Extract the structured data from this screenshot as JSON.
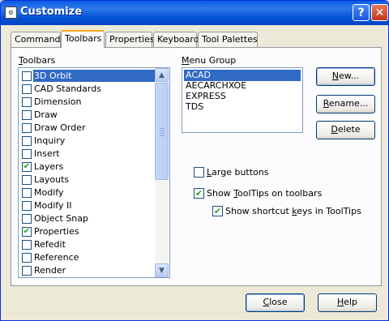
{
  "window": {
    "title": "Customize",
    "help_glyph": "?",
    "close_glyph": "✕",
    "app_icon": "⚙"
  },
  "tabs": [
    {
      "label": "Commands"
    },
    {
      "label": "Toolbars"
    },
    {
      "label": "Properties"
    },
    {
      "label": "Keyboard"
    },
    {
      "label": "Tool Palettes"
    }
  ],
  "active_tab": "Toolbars",
  "toolbars_section": {
    "label_access": "T",
    "label_rest": "oolbars",
    "items": [
      {
        "label": "3D Orbit",
        "checked": false,
        "selected": true
      },
      {
        "label": "CAD Standards",
        "checked": false
      },
      {
        "label": "Dimension",
        "checked": false
      },
      {
        "label": "Draw",
        "checked": false
      },
      {
        "label": "Draw Order",
        "checked": false
      },
      {
        "label": "Inquiry",
        "checked": false
      },
      {
        "label": "Insert",
        "checked": false
      },
      {
        "label": "Layers",
        "checked": true
      },
      {
        "label": "Layouts",
        "checked": false
      },
      {
        "label": "Modify",
        "checked": false
      },
      {
        "label": "Modify II",
        "checked": false
      },
      {
        "label": "Object Snap",
        "checked": false
      },
      {
        "label": "Properties",
        "checked": true
      },
      {
        "label": "Refedit",
        "checked": false
      },
      {
        "label": "Reference",
        "checked": false
      },
      {
        "label": "Render",
        "checked": false
      }
    ]
  },
  "menu_group": {
    "label_pre": "",
    "label_access": "M",
    "label_rest": "enu Group",
    "items": [
      {
        "label": "ACAD",
        "selected": true
      },
      {
        "label": "AECARCHXOE"
      },
      {
        "label": "EXPRESS"
      },
      {
        "label": "TDS"
      }
    ]
  },
  "buttons": {
    "new": {
      "access": "N",
      "rest": "ew..."
    },
    "rename": {
      "access": "R",
      "rest": "ename..."
    },
    "delete": {
      "access": "D",
      "rest": "elete"
    },
    "close": {
      "access": "C",
      "rest": "lose"
    },
    "help": {
      "access": "H",
      "rest": "elp"
    }
  },
  "options": {
    "large_buttons": {
      "pre": "",
      "access": "L",
      "rest": "arge buttons",
      "checked": false
    },
    "show_tooltips": {
      "pre": "Show ",
      "access": "T",
      "rest": "oolTips on toolbars",
      "checked": true
    },
    "show_shortcut": {
      "pre": "Show shortcut ",
      "access": "k",
      "rest": "eys in ToolTips",
      "checked": true
    }
  },
  "check_glyph": "✔",
  "icons": {
    "scroll_up": "▲",
    "scroll_down": "▼"
  }
}
